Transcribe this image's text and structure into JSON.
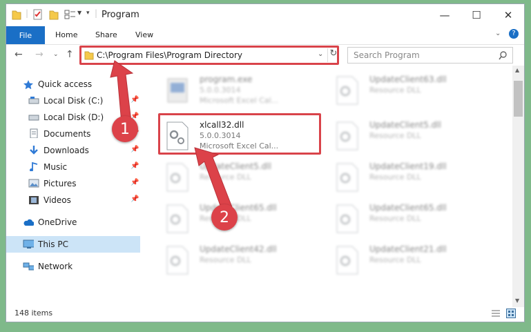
{
  "window": {
    "title": "Program"
  },
  "ribbon": {
    "file": "File",
    "tabs": [
      "Home",
      "Share",
      "View"
    ]
  },
  "address": {
    "path": "C:\\Program Files\\Program Directory"
  },
  "search": {
    "placeholder": "Search Program"
  },
  "sidebar": {
    "items": [
      {
        "label": "Quick access",
        "icon": "star-icon",
        "pinned": false
      },
      {
        "label": "Local Disk (C:)",
        "icon": "drive-icon",
        "pinned": true
      },
      {
        "label": "Local Disk (D:)",
        "icon": "drive-icon",
        "pinned": true
      },
      {
        "label": "Documents",
        "icon": "documents-icon",
        "pinned": true
      },
      {
        "label": "Downloads",
        "icon": "download-icon",
        "pinned": true
      },
      {
        "label": "Music",
        "icon": "music-icon",
        "pinned": true
      },
      {
        "label": "Pictures",
        "icon": "pictures-icon",
        "pinned": true
      },
      {
        "label": "Videos",
        "icon": "videos-icon",
        "pinned": true
      },
      {
        "label": "OneDrive",
        "icon": "cloud-icon",
        "pinned": false
      },
      {
        "label": "This PC",
        "icon": "computer-icon",
        "pinned": false,
        "selected": true
      },
      {
        "label": "Network",
        "icon": "network-icon",
        "pinned": false
      }
    ]
  },
  "files": {
    "col1": [
      {
        "name": "program.exe",
        "line1": "5.0.0.3014",
        "line2": "Microsoft Excel Cal...",
        "blurred": true
      },
      {
        "name": "xlcall32.dll",
        "line1": "5.0.0.3014",
        "line2": "Microsoft Excel Cal...",
        "blurred": false
      },
      {
        "name": "UpdateClient5.dll",
        "line1": "Resource DLL",
        "line2": "",
        "blurred": true
      },
      {
        "name": "UpdateClient65.dll",
        "line1": "Resource DLL",
        "line2": "",
        "blurred": true
      },
      {
        "name": "UpdateClient42.dll",
        "line1": "Resource DLL",
        "line2": "",
        "blurred": true
      }
    ],
    "col2": [
      {
        "name": "UpdateClient63.dll",
        "line1": "Resource DLL",
        "blurred": true
      },
      {
        "name": "UpdateClient5.dll",
        "line1": "Resource DLL",
        "blurred": true
      },
      {
        "name": "UpdateClient19.dll",
        "line1": "Resource DLL",
        "blurred": true
      },
      {
        "name": "UpdateClient65.dll",
        "line1": "Resource DLL",
        "blurred": true
      },
      {
        "name": "UpdateClient21.dll",
        "line1": "Resource DLL",
        "blurred": true
      }
    ]
  },
  "status": {
    "count": "148 items"
  },
  "callouts": [
    "1",
    "2"
  ],
  "colors": {
    "accent": "#1a6fc6",
    "highlight": "#d9434a",
    "selection": "#cce4f7"
  }
}
